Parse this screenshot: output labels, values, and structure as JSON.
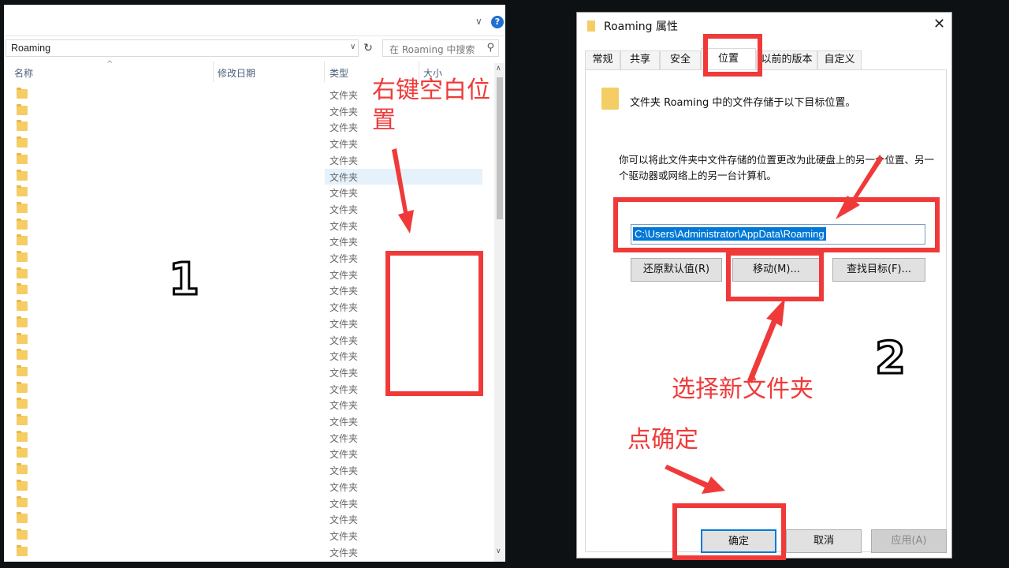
{
  "explorer": {
    "address": "Roaming",
    "search_placeholder": "在 Roaming 中搜索",
    "help_label": "?",
    "columns": {
      "name": "名称",
      "modified": "修改日期",
      "type": "类型",
      "size": "大小"
    },
    "row_type": "文件夹",
    "row_count": 29,
    "selected_row": 5
  },
  "dialog": {
    "title": "Roaming 属性",
    "tabs": [
      "常规",
      "共享",
      "安全",
      "位置",
      "以前的版本",
      "自定义"
    ],
    "active_tab": "位置",
    "info_line": "文件夹 Roaming 中的文件存储于以下目标位置。",
    "description": "你可以将此文件夹中文件存储的位置更改为此硬盘上的另一个位置、另一个驱动器或网络上的另一台计算机。",
    "path": "C:\\Users\\Administrator\\AppData\\Roaming",
    "buttons": {
      "restore": "还原默认值(R)",
      "move": "移动(M)...",
      "find_target": "查找目标(F)...",
      "ok": "确定",
      "cancel": "取消",
      "apply": "应用(A)"
    }
  },
  "annotations": {
    "step1": "1",
    "step2": "2",
    "right_click_hint": "右键空白位置",
    "choose_folder_hint": "选择新文件夹",
    "click_ok_hint": "点确定",
    "color": "#f03a3a"
  }
}
